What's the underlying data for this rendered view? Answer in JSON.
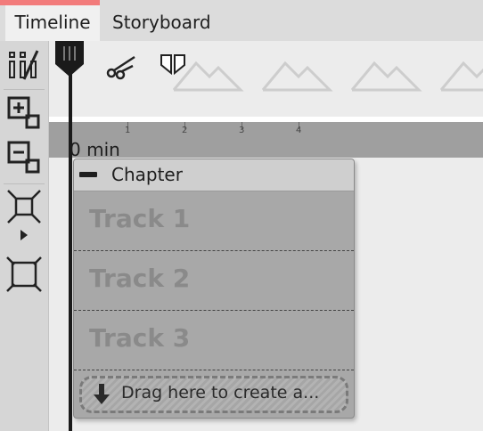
{
  "tabs": [
    {
      "label": "Timeline",
      "active": true
    },
    {
      "label": "Storyboard",
      "active": false
    }
  ],
  "left_toolbar": {
    "icons": [
      "split-columns-icon",
      "add-chapter-icon",
      "remove-chapter-icon",
      "shrink-icon",
      "expand-icon"
    ]
  },
  "toolbar": {
    "icons": [
      "playhead-icon",
      "scissors-icon",
      "marker-icon"
    ]
  },
  "ruler": {
    "ticks": [
      "1",
      "2",
      "3",
      "4"
    ],
    "start_label": "0 min"
  },
  "chapter": {
    "title": "Chapter",
    "tracks": [
      "Track 1",
      "Track 2",
      "Track 3"
    ],
    "dropzone_label": "Drag here to create a..."
  },
  "colors": {
    "active_tab_accent": "#f27b7b",
    "track_bg": "#a8a8a8",
    "ruler_bg": "#9f9f9f"
  }
}
